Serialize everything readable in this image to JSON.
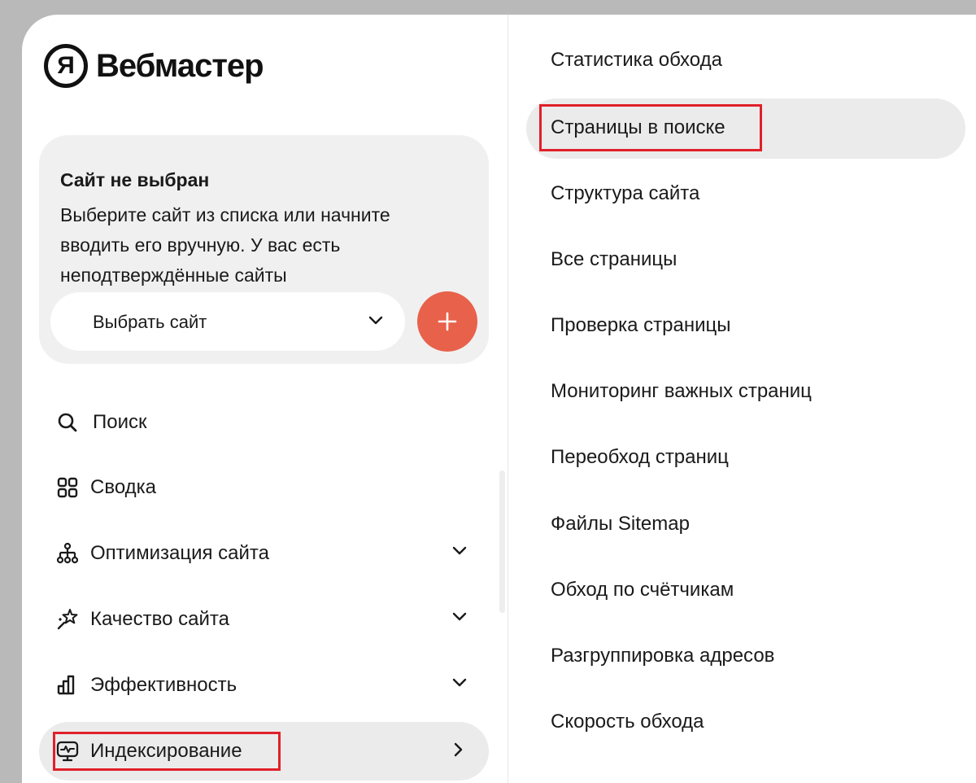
{
  "app": {
    "logo_letter": "Я",
    "logo_text": "Вебмастер"
  },
  "site_card": {
    "title": "Сайт не выбран",
    "description": "Выберите сайт из списка или начните вводить его вручную. У вас есть неподтверждённые сайты",
    "select_label": "Выбрать сайт",
    "add_icon": "plus-icon"
  },
  "nav": {
    "items": [
      {
        "label": "Поиск",
        "icon": "search-icon"
      },
      {
        "label": "Сводка",
        "icon": "grid-icon"
      },
      {
        "label": "Оптимизация сайта",
        "icon": "sitemap-icon",
        "expandable": true
      },
      {
        "label": "Качество сайта",
        "icon": "sparkle-star-icon",
        "expandable": true
      },
      {
        "label": "Эффективность",
        "icon": "bar-chart-icon",
        "expandable": true
      },
      {
        "label": "Индексирование",
        "icon": "monitor-pulse-icon",
        "expandable": true,
        "active": true
      }
    ]
  },
  "submenu": {
    "items": [
      {
        "label": "Статистика обхода"
      },
      {
        "label": "Страницы в поиске",
        "active": true
      },
      {
        "label": "Структура сайта"
      },
      {
        "label": "Все страницы"
      },
      {
        "label": "Проверка страницы"
      },
      {
        "label": "Мониторинг важных страниц"
      },
      {
        "label": "Переобход страниц"
      },
      {
        "label": "Файлы Sitemap"
      },
      {
        "label": "Обход по счётчикам"
      },
      {
        "label": "Разгруппировка адресов"
      },
      {
        "label": "Скорость обхода"
      }
    ]
  },
  "colors": {
    "accent": "#e8614b",
    "highlight": "#e0202a",
    "active_bg": "#ebebeb",
    "card_bg": "#f0f0f0"
  }
}
